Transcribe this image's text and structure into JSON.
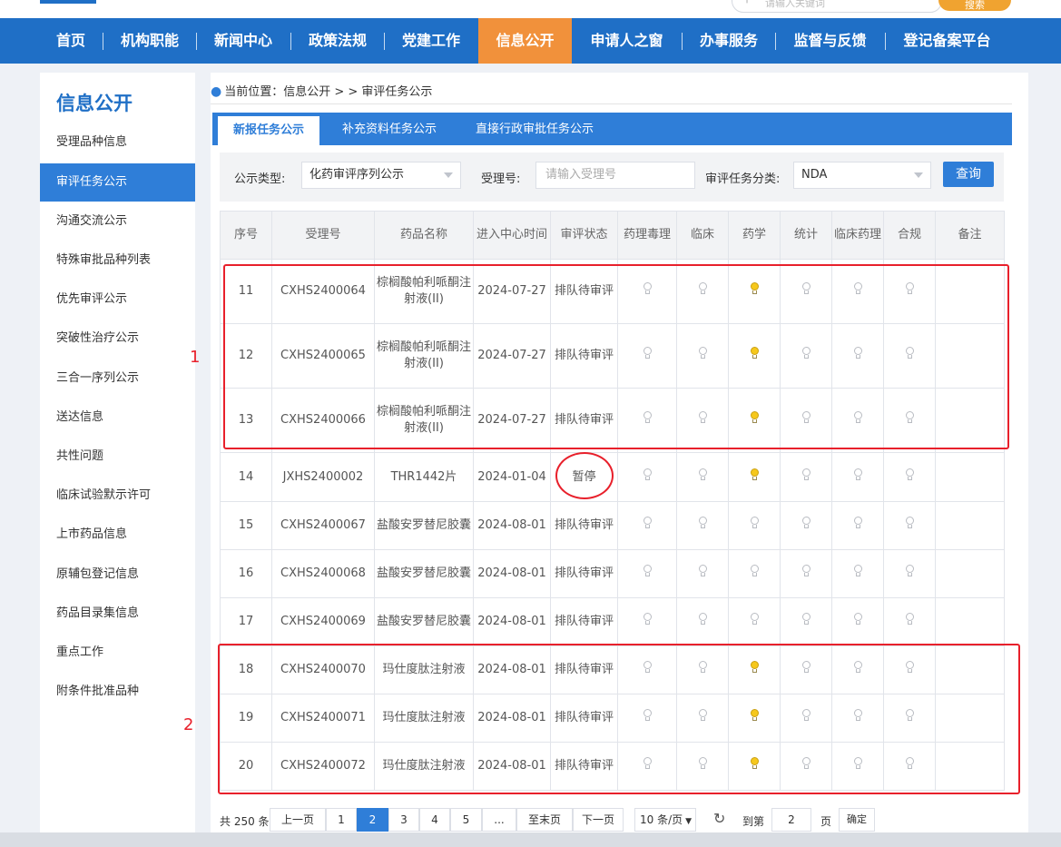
{
  "header": {
    "search_placeholder": "请输入关键词",
    "search_button": "搜索"
  },
  "nav": {
    "items": [
      "首页",
      "机构职能",
      "新闻中心",
      "政策法规",
      "党建工作",
      "信息公开",
      "申请人之窗",
      "办事服务",
      "监督与反馈",
      "登记备案平台"
    ],
    "active": "信息公开"
  },
  "sidebar": {
    "title": "信息公开",
    "items": [
      "受理品种信息",
      "审评任务公示",
      "沟通交流公示",
      "特殊审批品种列表",
      "优先审评公示",
      "突破性治疗公示",
      "三合一序列公示",
      "送达信息",
      "共性问题",
      "临床试验默示许可",
      "上市药品信息",
      "原辅包登记信息",
      "药品目录集信息",
      "重点工作",
      "附条件批准品种"
    ],
    "active": "审评任务公示"
  },
  "breadcrumb": {
    "prefix": "当前位置：",
    "path": "信息公开 > > 审评任务公示"
  },
  "tabs": [
    "新报任务公示",
    "补充资料任务公示",
    "直接行政审批任务公示"
  ],
  "filter": {
    "type_label": "公示类型:",
    "type_value": "化药审评序列公示",
    "accept_label": "受理号:",
    "accept_placeholder": "请输入受理号",
    "task_label": "审评任务分类:",
    "task_value": "NDA",
    "query_button": "查询"
  },
  "table": {
    "headers": [
      "序号",
      "受理号",
      "药品名称",
      "进入中心时间",
      "审评状态",
      "药理毒理",
      "临床",
      "药学",
      "统计",
      "临床药理",
      "合规",
      "备注"
    ],
    "rows": [
      {
        "no": "11",
        "id": "CXHS2400064",
        "name": "棕榈酸帕利哌酮注射液(II)",
        "date": "2024-07-27",
        "status": "排队待审评",
        "lights": [
          0,
          0,
          1,
          0,
          0,
          0
        ],
        "note": ""
      },
      {
        "no": "12",
        "id": "CXHS2400065",
        "name": "棕榈酸帕利哌酮注射液(II)",
        "date": "2024-07-27",
        "status": "排队待审评",
        "lights": [
          0,
          0,
          1,
          0,
          0,
          0
        ],
        "note": ""
      },
      {
        "no": "13",
        "id": "CXHS2400066",
        "name": "棕榈酸帕利哌酮注射液(II)",
        "date": "2024-07-27",
        "status": "排队待审评",
        "lights": [
          0,
          0,
          1,
          0,
          0,
          0
        ],
        "note": ""
      },
      {
        "no": "14",
        "id": "JXHS2400002",
        "name": "THR1442片",
        "date": "2024-01-04",
        "status": "暂停",
        "lights": [
          0,
          0,
          1,
          0,
          0,
          0
        ],
        "note": ""
      },
      {
        "no": "15",
        "id": "CXHS2400067",
        "name": "盐酸安罗替尼胶囊",
        "date": "2024-08-01",
        "status": "排队待审评",
        "lights": [
          0,
          0,
          0,
          0,
          0,
          0
        ],
        "note": ""
      },
      {
        "no": "16",
        "id": "CXHS2400068",
        "name": "盐酸安罗替尼胶囊",
        "date": "2024-08-01",
        "status": "排队待审评",
        "lights": [
          0,
          0,
          0,
          0,
          0,
          0
        ],
        "note": ""
      },
      {
        "no": "17",
        "id": "CXHS2400069",
        "name": "盐酸安罗替尼胶囊",
        "date": "2024-08-01",
        "status": "排队待审评",
        "lights": [
          0,
          0,
          0,
          0,
          0,
          0
        ],
        "note": ""
      },
      {
        "no": "18",
        "id": "CXHS2400070",
        "name": "玛仕度肽注射液",
        "date": "2024-08-01",
        "status": "排队待审评",
        "lights": [
          0,
          0,
          1,
          0,
          0,
          0
        ],
        "note": ""
      },
      {
        "no": "19",
        "id": "CXHS2400071",
        "name": "玛仕度肽注射液",
        "date": "2024-08-01",
        "status": "排队待审评",
        "lights": [
          0,
          0,
          1,
          0,
          0,
          0
        ],
        "note": ""
      },
      {
        "no": "20",
        "id": "CXHS2400072",
        "name": "玛仕度肽注射液",
        "date": "2024-08-01",
        "status": "排队待审评",
        "lights": [
          0,
          0,
          1,
          0,
          0,
          0
        ],
        "note": ""
      }
    ]
  },
  "annotations": {
    "label1": "1",
    "label2": "2"
  },
  "pagination": {
    "total": "共 250 条",
    "prev": "上一页",
    "pages": [
      "1",
      "2",
      "3",
      "4",
      "5",
      "..."
    ],
    "current": "2",
    "last": "至末页",
    "next": "下一页",
    "page_size": "10 条/页",
    "goto_label": "到第",
    "goto_value": "2",
    "page_unit": "页",
    "confirm": "确定"
  },
  "colors": {
    "nav": "#1f6fc6",
    "nav_active": "#f1913b",
    "accent": "#2f7ed8",
    "annotation": "#e8202b",
    "bulb_on": "#f6c81c"
  }
}
